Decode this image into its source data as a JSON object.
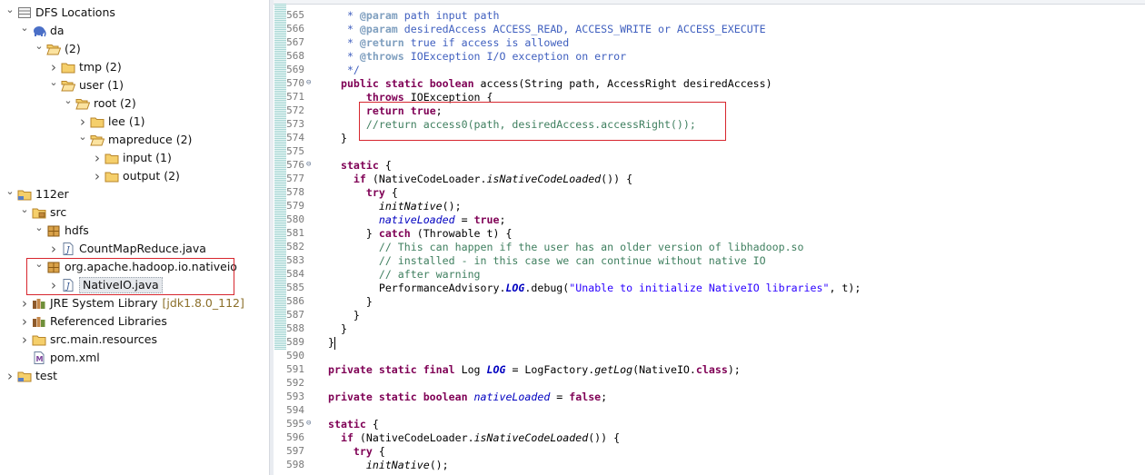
{
  "tree": [
    {
      "indent": 0,
      "twisty": "expanded",
      "icon": "dfs-icon",
      "label": "DFS Locations"
    },
    {
      "indent": 1,
      "twisty": "expanded",
      "icon": "elephant-icon",
      "label": "da"
    },
    {
      "indent": 2,
      "twisty": "expanded",
      "icon": "folder-open-icon",
      "label": "(2)"
    },
    {
      "indent": 3,
      "twisty": "collapsed",
      "icon": "folder-icon",
      "label": "tmp (2)"
    },
    {
      "indent": 3,
      "twisty": "expanded",
      "icon": "folder-open-icon",
      "label": "user (1)"
    },
    {
      "indent": 4,
      "twisty": "expanded",
      "icon": "folder-open-icon",
      "label": "root (2)"
    },
    {
      "indent": 5,
      "twisty": "collapsed",
      "icon": "folder-icon",
      "label": "lee (1)"
    },
    {
      "indent": 5,
      "twisty": "expanded",
      "icon": "folder-open-icon",
      "label": "mapreduce (2)"
    },
    {
      "indent": 6,
      "twisty": "collapsed",
      "icon": "folder-icon",
      "label": "input (1)"
    },
    {
      "indent": 6,
      "twisty": "collapsed",
      "icon": "folder-icon",
      "label": "output (2)"
    },
    {
      "indent": 0,
      "twisty": "expanded",
      "icon": "project-icon",
      "label": "112er"
    },
    {
      "indent": 1,
      "twisty": "expanded",
      "icon": "source-folder-icon",
      "label": "src"
    },
    {
      "indent": 2,
      "twisty": "expanded",
      "icon": "package-icon",
      "label": "hdfs"
    },
    {
      "indent": 3,
      "twisty": "collapsed",
      "icon": "java-file-icon",
      "label": "CountMapReduce.java"
    },
    {
      "indent": 2,
      "twisty": "expanded",
      "icon": "package-icon",
      "label": "org.apache.hadoop.io.nativeio"
    },
    {
      "indent": 3,
      "twisty": "collapsed",
      "icon": "java-file-icon",
      "label": "NativeIO.java",
      "selected": true
    },
    {
      "indent": 1,
      "twisty": "collapsed",
      "icon": "library-icon",
      "label": "JRE System Library",
      "decoration": "[jdk1.8.0_112]"
    },
    {
      "indent": 1,
      "twisty": "collapsed",
      "icon": "library-icon",
      "label": "Referenced Libraries"
    },
    {
      "indent": 1,
      "twisty": "collapsed",
      "icon": "folder-icon",
      "label": "src.main.resources"
    },
    {
      "indent": 1,
      "twisty": "none",
      "icon": "xml-file-icon",
      "label": "pom.xml"
    },
    {
      "indent": 0,
      "twisty": "collapsed",
      "icon": "project-icon",
      "label": "test"
    }
  ],
  "code_lines": [
    {
      "n": "565",
      "fold": "",
      "segs": [
        [
          "jd",
          "   * "
        ],
        [
          "tag",
          "@param"
        ],
        [
          "jd",
          " path input path"
        ]
      ]
    },
    {
      "n": "566",
      "fold": "",
      "segs": [
        [
          "jd",
          "   * "
        ],
        [
          "tag",
          "@param"
        ],
        [
          "jd",
          " desiredAccess ACCESS_READ, ACCESS_WRITE or ACCESS_EXECUTE"
        ]
      ]
    },
    {
      "n": "567",
      "fold": "",
      "segs": [
        [
          "jd",
          "   * "
        ],
        [
          "tag",
          "@return"
        ],
        [
          "jd",
          " true if access is allowed"
        ]
      ]
    },
    {
      "n": "568",
      "fold": "",
      "segs": [
        [
          "jd",
          "   * "
        ],
        [
          "tag",
          "@throws"
        ],
        [
          "jd",
          " IOException I/O exception on error"
        ]
      ]
    },
    {
      "n": "569",
      "fold": "",
      "segs": [
        [
          "jd",
          "   */"
        ]
      ]
    },
    {
      "n": "570",
      "fold": "⊖",
      "segs": [
        [
          "pl",
          "  "
        ],
        [
          "kw",
          "public static boolean"
        ],
        [
          "pl",
          " access(String path, AccessRight desiredAccess)"
        ]
      ]
    },
    {
      "n": "571",
      "fold": "",
      "segs": [
        [
          "pl",
          "      "
        ],
        [
          "kw",
          "throws"
        ],
        [
          "pl",
          " IOException {"
        ]
      ]
    },
    {
      "n": "572",
      "fold": "",
      "segs": [
        [
          "pl",
          "      "
        ],
        [
          "kw",
          "return true"
        ],
        [
          "pl",
          ";"
        ]
      ]
    },
    {
      "n": "573",
      "fold": "",
      "segs": [
        [
          "pl",
          "      "
        ],
        [
          "cm",
          "//return access0(path, desiredAccess.accessRight());"
        ]
      ]
    },
    {
      "n": "574",
      "fold": "",
      "segs": [
        [
          "pl",
          "  }"
        ]
      ]
    },
    {
      "n": "575",
      "fold": "",
      "segs": []
    },
    {
      "n": "576",
      "fold": "⊖",
      "segs": [
        [
          "pl",
          "  "
        ],
        [
          "kw",
          "static"
        ],
        [
          "pl",
          " {"
        ]
      ]
    },
    {
      "n": "577",
      "fold": "",
      "segs": [
        [
          "pl",
          "    "
        ],
        [
          "kw",
          "if"
        ],
        [
          "pl",
          " (NativeCodeLoader."
        ],
        [
          "it",
          "isNativeCodeLoaded"
        ],
        [
          "pl",
          "()) {"
        ]
      ]
    },
    {
      "n": "578",
      "fold": "",
      "segs": [
        [
          "pl",
          "      "
        ],
        [
          "kw",
          "try"
        ],
        [
          "pl",
          " {"
        ]
      ]
    },
    {
      "n": "579",
      "fold": "",
      "segs": [
        [
          "pl",
          "        "
        ],
        [
          "it",
          "initNative"
        ],
        [
          "pl",
          "();"
        ]
      ]
    },
    {
      "n": "580",
      "fold": "",
      "segs": [
        [
          "pl",
          "        "
        ],
        [
          "fi",
          "nativeLoaded"
        ],
        [
          "pl",
          " = "
        ],
        [
          "kw",
          "true"
        ],
        [
          "pl",
          ";"
        ]
      ]
    },
    {
      "n": "581",
      "fold": "",
      "segs": [
        [
          "pl",
          "      } "
        ],
        [
          "kw",
          "catch"
        ],
        [
          "pl",
          " (Throwable t) {"
        ]
      ]
    },
    {
      "n": "582",
      "fold": "",
      "segs": [
        [
          "pl",
          "        "
        ],
        [
          "cm",
          "// This can happen if the user has an older version of libhadoop.so"
        ]
      ]
    },
    {
      "n": "583",
      "fold": "",
      "segs": [
        [
          "pl",
          "        "
        ],
        [
          "cm",
          "// installed - in this case we can continue without native IO"
        ]
      ]
    },
    {
      "n": "584",
      "fold": "",
      "segs": [
        [
          "pl",
          "        "
        ],
        [
          "cm",
          "// after warning"
        ]
      ]
    },
    {
      "n": "585",
      "fold": "",
      "segs": [
        [
          "pl",
          "        PerformanceAdvisory."
        ],
        [
          "sf",
          "LOG"
        ],
        [
          "pl",
          ".debug("
        ],
        [
          "st",
          "\"Unable to initialize NativeIO libraries\""
        ],
        [
          "pl",
          ", t);"
        ]
      ]
    },
    {
      "n": "586",
      "fold": "",
      "segs": [
        [
          "pl",
          "      }"
        ]
      ]
    },
    {
      "n": "587",
      "fold": "",
      "segs": [
        [
          "pl",
          "    }"
        ]
      ]
    },
    {
      "n": "588",
      "fold": "",
      "segs": [
        [
          "pl",
          "  }"
        ]
      ]
    },
    {
      "n": "589",
      "fold": "",
      "segs": [
        [
          "pl",
          "}"
        ],
        [
          "cur",
          ""
        ]
      ]
    },
    {
      "n": "590",
      "fold": "",
      "segs": []
    },
    {
      "n": "591",
      "fold": "",
      "segs": [
        [
          "kw",
          "private static final"
        ],
        [
          "pl",
          " Log "
        ],
        [
          "sf",
          "LOG"
        ],
        [
          "pl",
          " = LogFactory."
        ],
        [
          "it",
          "getLog"
        ],
        [
          "pl",
          "(NativeIO."
        ],
        [
          "kw",
          "class"
        ],
        [
          "pl",
          ");"
        ]
      ]
    },
    {
      "n": "592",
      "fold": "",
      "segs": []
    },
    {
      "n": "593",
      "fold": "",
      "segs": [
        [
          "kw",
          "private static boolean"
        ],
        [
          "pl",
          " "
        ],
        [
          "fi",
          "nativeLoaded"
        ],
        [
          "pl",
          " = "
        ],
        [
          "kw",
          "false"
        ],
        [
          "pl",
          ";"
        ]
      ]
    },
    {
      "n": "594",
      "fold": "",
      "segs": []
    },
    {
      "n": "595",
      "fold": "⊖",
      "segs": [
        [
          "kw",
          "static"
        ],
        [
          "pl",
          " {"
        ]
      ]
    },
    {
      "n": "596",
      "fold": "",
      "segs": [
        [
          "pl",
          "  "
        ],
        [
          "kw",
          "if"
        ],
        [
          "pl",
          " (NativeCodeLoader."
        ],
        [
          "it",
          "isNativeCodeLoaded"
        ],
        [
          "pl",
          "()) {"
        ]
      ]
    },
    {
      "n": "597",
      "fold": "",
      "segs": [
        [
          "pl",
          "    "
        ],
        [
          "kw",
          "try"
        ],
        [
          "pl",
          " {"
        ]
      ]
    },
    {
      "n": "598",
      "fold": "",
      "segs": [
        [
          "pl",
          "      "
        ],
        [
          "it",
          "initNative"
        ],
        [
          "pl",
          "();"
        ]
      ]
    }
  ]
}
